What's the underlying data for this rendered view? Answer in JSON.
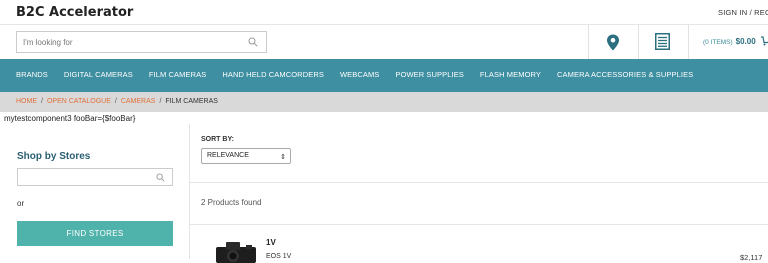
{
  "header": {
    "brand": "B2C Accelerator",
    "signin": "SIGN IN / REGIST"
  },
  "search": {
    "placeholder": "I'm looking for",
    "value": ""
  },
  "cart": {
    "items_label": "(0 ITEMS)",
    "amount": "$0.00"
  },
  "nav": {
    "items": [
      "BRANDS",
      "DIGITAL CAMERAS",
      "FILM CAMERAS",
      "HAND HELD CAMCORDERS",
      "WEBCAMS",
      "POWER SUPPLIES",
      "FLASH MEMORY",
      "CAMERA ACCESSORIES & SUPPLIES"
    ]
  },
  "breadcrumb": {
    "home": "HOME",
    "catalogue": "OPEN CATALOGUE",
    "cameras": "CAMERAS",
    "current": "FILM CAMERAS",
    "separator": "/"
  },
  "component_line": "mytestcomponent3 fooBar={$fooBar}",
  "sidebar": {
    "title": "Shop by Stores",
    "store_value": "",
    "or": "or",
    "find_button": "FIND STORES"
  },
  "results": {
    "sort_label": "SORT BY:",
    "sort_selected": "RELEVANCE",
    "count_text": "2 Products found"
  },
  "product": {
    "name": "1V",
    "subtitle": "EOS 1V",
    "price": "$2,117"
  },
  "colors": {
    "nav_bg": "#3e8fa1",
    "accent_link": "#e0703a",
    "button_bg": "#4fb3ab",
    "title_color": "#2b5e72"
  }
}
